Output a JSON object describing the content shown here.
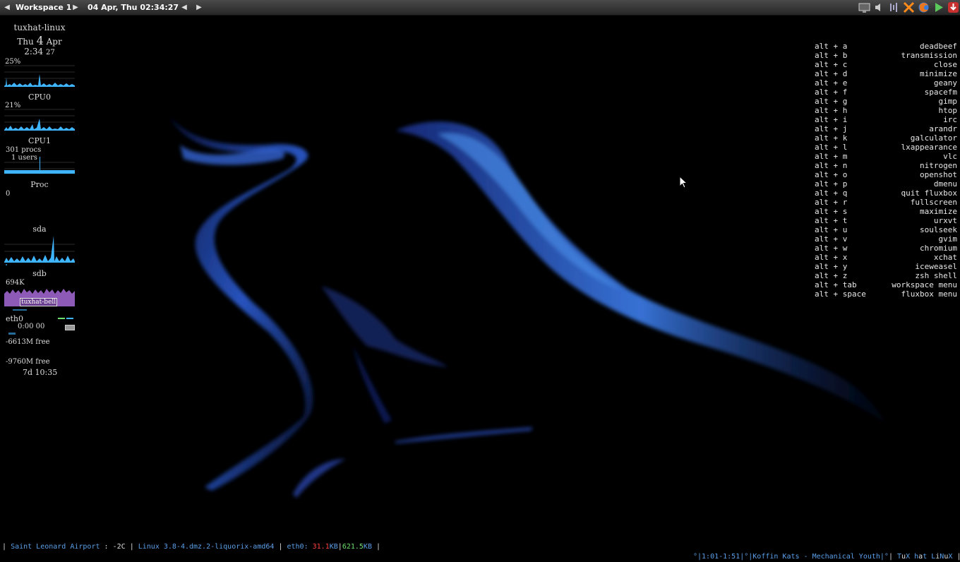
{
  "toolbar": {
    "workspace": "Workspace 1",
    "datetime": "04 Apr, Thu 02:34:27",
    "prev_workspace_glyph": "◀",
    "next_workspace_glyph": "▶",
    "prev_window_glyph": "◀",
    "next_window_glyph": "▶",
    "tray_icons": [
      "display-icon",
      "volume-icon",
      "sound-waves-icon",
      "conky-close-icon",
      "firefox-icon",
      "play-icon",
      "download-icon"
    ]
  },
  "conky": {
    "hostname": "tuxhat-linux",
    "day": "Thu",
    "date_num": "4",
    "month": "Apr",
    "time": "2:34",
    "seconds": "27",
    "cpu0_pct": "25%",
    "cpu0_label": "CPU0",
    "cpu1_pct": "21%",
    "cpu1_label": "CPU1",
    "procs": "301 procs",
    "users": "1 users",
    "proc_label": "Proc",
    "proc_value": "0",
    "sda_label": "sda",
    "sdb_label": "sdb",
    "sdb_value": "694K",
    "bell_label": "tuxhat-bell",
    "eth_label": "eth0",
    "eth_time": "0:00 00",
    "mem_free": "-6613M free",
    "swap_free": "-9760M free",
    "uptime": "7d 10:35"
  },
  "keybindings": [
    {
      "combo": "alt + a",
      "app": "deadbeef"
    },
    {
      "combo": "alt + b",
      "app": "transmission"
    },
    {
      "combo": "alt + c",
      "app": "close"
    },
    {
      "combo": "alt + d",
      "app": "minimize"
    },
    {
      "combo": "alt + e",
      "app": "geany"
    },
    {
      "combo": "alt + f",
      "app": "spacefm"
    },
    {
      "combo": "alt + g",
      "app": "gimp"
    },
    {
      "combo": "alt + h",
      "app": "htop"
    },
    {
      "combo": "alt + i",
      "app": "irc"
    },
    {
      "combo": "alt + j",
      "app": "arandr"
    },
    {
      "combo": "alt + k",
      "app": "galculator"
    },
    {
      "combo": "alt + l",
      "app": "lxappearance"
    },
    {
      "combo": "alt + m",
      "app": "vlc"
    },
    {
      "combo": "alt + n",
      "app": "nitrogen"
    },
    {
      "combo": "alt + o",
      "app": "openshot"
    },
    {
      "combo": "alt + p",
      "app": "dmenu"
    },
    {
      "combo": "alt + q",
      "app": "quit fluxbox"
    },
    {
      "combo": "alt + r",
      "app": "fullscreen"
    },
    {
      "combo": "alt + s",
      "app": "maximize"
    },
    {
      "combo": "alt + t",
      "app": "urxvt"
    },
    {
      "combo": "alt + u",
      "app": "soulseek"
    },
    {
      "combo": "alt + v",
      "app": "gvim"
    },
    {
      "combo": "alt + w",
      "app": "chromium"
    },
    {
      "combo": "alt + x",
      "app": "xchat"
    },
    {
      "combo": "alt + y",
      "app": "iceweasel"
    },
    {
      "combo": "alt + z",
      "app": "zsh shell"
    },
    {
      "combo": "alt + tab",
      "app": "workspace menu"
    },
    {
      "combo": "alt + space",
      "app": "fluxbox menu"
    }
  ],
  "bottombar": {
    "sep": "|",
    "location": "Saint Leonard Airport",
    "temp_sep": ":",
    "temp": "-2C",
    "kernel": "Linux 3.8-4.dmz.2-liquorix-amd64",
    "iface": "eth0:",
    "down_value": "31.1",
    "down_unit": "KB",
    "up_value": "621.5",
    "up_unit": "KB",
    "music": "°|1:01-1:51|°|Koffin Kats - Mechanical Youth|°",
    "brand_t": "T",
    "brand_u": "u",
    "brand_x": "X ",
    "brand_h": "h",
    "brand_a": "a",
    "brand_t2": "t ",
    "brand_l": "L",
    "brand_i": "i",
    "brand_n": "N",
    "brand_u2": "u",
    "brand_x2": "X"
  },
  "colors": {
    "graph_blue": "#3fb4ff",
    "bell_purple": "#8e5ab8",
    "bar_blue": "#5a9fe8",
    "red": "#ff4040",
    "green": "#6ee06e"
  }
}
